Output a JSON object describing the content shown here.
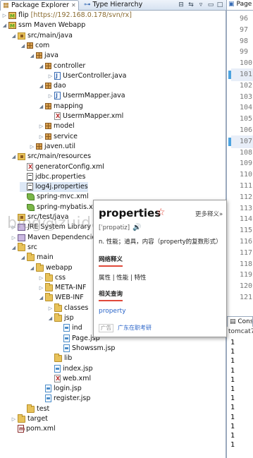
{
  "package_explorer": {
    "tab_label": "Package Explorer",
    "type_hierarchy_label": "Type Hierarchy"
  },
  "tree": [
    {
      "label": "flip",
      "suffix": " [https://192.168.0.178/svn/rx]",
      "depth": 0,
      "twisty": "right",
      "icon": "svn-project-icon"
    },
    {
      "label": "ssm Maven Webapp",
      "depth": 0,
      "twisty": "down",
      "icon": "maven-project-icon"
    },
    {
      "label": "src/main/java",
      "depth": 1,
      "twisty": "down",
      "icon": "source-folder-icon"
    },
    {
      "label": "com",
      "depth": 2,
      "twisty": "down",
      "icon": "package-icon"
    },
    {
      "label": "java",
      "depth": 3,
      "twisty": "down",
      "icon": "package-icon"
    },
    {
      "label": "controller",
      "depth": 4,
      "twisty": "down",
      "icon": "package-icon"
    },
    {
      "label": "UserController.java",
      "depth": 5,
      "twisty": "right",
      "icon": "java-file-icon"
    },
    {
      "label": "dao",
      "depth": 4,
      "twisty": "down",
      "icon": "package-icon"
    },
    {
      "label": "UsermMapper.java",
      "depth": 5,
      "twisty": "right",
      "icon": "java-file-icon"
    },
    {
      "label": "mapping",
      "depth": 4,
      "twisty": "down",
      "icon": "package-icon"
    },
    {
      "label": "UsermMapper.xml",
      "depth": 5,
      "twisty": "",
      "icon": "xml-file-icon"
    },
    {
      "label": "model",
      "depth": 4,
      "twisty": "right",
      "icon": "package-icon"
    },
    {
      "label": "service",
      "depth": 4,
      "twisty": "right",
      "icon": "package-icon"
    },
    {
      "label": "javen.util",
      "depth": 3,
      "twisty": "right",
      "icon": "package-icon"
    },
    {
      "label": "src/main/resources",
      "depth": 1,
      "twisty": "down",
      "icon": "source-folder-icon"
    },
    {
      "label": "generatorConfig.xml",
      "depth": 2,
      "twisty": "",
      "icon": "xml-file-icon"
    },
    {
      "label": "jdbc.properties",
      "depth": 2,
      "twisty": "",
      "icon": "properties-file-icon"
    },
    {
      "label": "log4j.properties",
      "depth": 2,
      "twisty": "",
      "icon": "properties-file-icon",
      "selected": true
    },
    {
      "label": "spring-mvc.xml",
      "depth": 2,
      "twisty": "",
      "icon": "spring-file-icon"
    },
    {
      "label": "spring-mybatis.x",
      "depth": 2,
      "twisty": "",
      "icon": "spring-file-icon"
    },
    {
      "label": "src/test/java",
      "depth": 1,
      "twisty": "",
      "icon": "source-folder-icon"
    },
    {
      "label": "JRE System Library",
      "depth": 1,
      "twisty": "right",
      "icon": "library-icon"
    },
    {
      "label": "Maven Dependencie",
      "depth": 1,
      "twisty": "right",
      "icon": "library-icon"
    },
    {
      "label": "src",
      "depth": 1,
      "twisty": "down",
      "icon": "folder-icon"
    },
    {
      "label": "main",
      "depth": 2,
      "twisty": "down",
      "icon": "folder-icon"
    },
    {
      "label": "webapp",
      "depth": 3,
      "twisty": "down",
      "icon": "folder-icon"
    },
    {
      "label": "css",
      "depth": 4,
      "twisty": "right",
      "icon": "folder-icon"
    },
    {
      "label": "META-INF",
      "depth": 4,
      "twisty": "right",
      "icon": "folder-icon"
    },
    {
      "label": "WEB-INF",
      "depth": 4,
      "twisty": "down",
      "icon": "folder-icon"
    },
    {
      "label": "classes",
      "depth": 5,
      "twisty": "right",
      "icon": "folder-icon"
    },
    {
      "label": "jsp",
      "depth": 5,
      "twisty": "down",
      "icon": "folder-icon"
    },
    {
      "label": "ind",
      "depth": 6,
      "twisty": "",
      "icon": "jsp-file-icon"
    },
    {
      "label": "Page.jsp",
      "depth": 6,
      "twisty": "",
      "icon": "jsp-file-icon"
    },
    {
      "label": "Showssm.jsp",
      "depth": 6,
      "twisty": "",
      "icon": "jsp-file-icon"
    },
    {
      "label": "lib",
      "depth": 5,
      "twisty": "",
      "icon": "folder-icon"
    },
    {
      "label": "index.jsp",
      "depth": 5,
      "twisty": "",
      "icon": "jsp-file-icon"
    },
    {
      "label": "web.xml",
      "depth": 5,
      "twisty": "",
      "icon": "xml-file-icon"
    },
    {
      "label": "login.jsp",
      "depth": 4,
      "twisty": "",
      "icon": "jsp-file-icon"
    },
    {
      "label": "register.jsp",
      "depth": 4,
      "twisty": "",
      "icon": "jsp-file-icon"
    },
    {
      "label": "test",
      "depth": 2,
      "twisty": "",
      "icon": "folder-icon"
    },
    {
      "label": "target",
      "depth": 1,
      "twisty": "right",
      "icon": "folder-icon"
    },
    {
      "label": "pom.xml",
      "depth": 1,
      "twisty": "",
      "icon": "maven-pom-icon"
    }
  ],
  "editor": {
    "tab_label": "Page",
    "line_numbers": [
      "96",
      "97",
      "98",
      "99",
      "100",
      "101",
      "102",
      "103",
      "104",
      "105",
      "106",
      "107",
      "108",
      "109",
      "110",
      "111",
      "112",
      "113",
      "114",
      "115",
      "116",
      "117",
      "118",
      "119",
      "120",
      "121"
    ],
    "highlight": [
      "101",
      "107"
    ]
  },
  "console": {
    "tab_label": "Cons",
    "server_label": "tomcat7",
    "lines": [
      "1",
      "1",
      "1",
      "1",
      "1",
      "1",
      "1",
      "1",
      "1",
      "1",
      "1",
      "1"
    ]
  },
  "dictionary_popup": {
    "word": "properties",
    "star": "☆",
    "more_label": "更多释义»",
    "phonetic": "[ˈprɒpətiz]",
    "speaker": "🔊",
    "definition": "n. 性能；道具，内容（property的复数形式）",
    "web_heading": "网络释义",
    "web_meanings": "属性 | 性能 | 特性",
    "related_heading": "相关查询",
    "related_link": "property",
    "ad_tag": "广告",
    "ad_text": "广东在职考研"
  },
  "watermark": "blog@zuidaima.com",
  "colors": {
    "accent_red": "#e0493a",
    "link_blue": "#2a64c8",
    "frame_border": "#9aa9bd",
    "selection": "#dde8f6"
  }
}
